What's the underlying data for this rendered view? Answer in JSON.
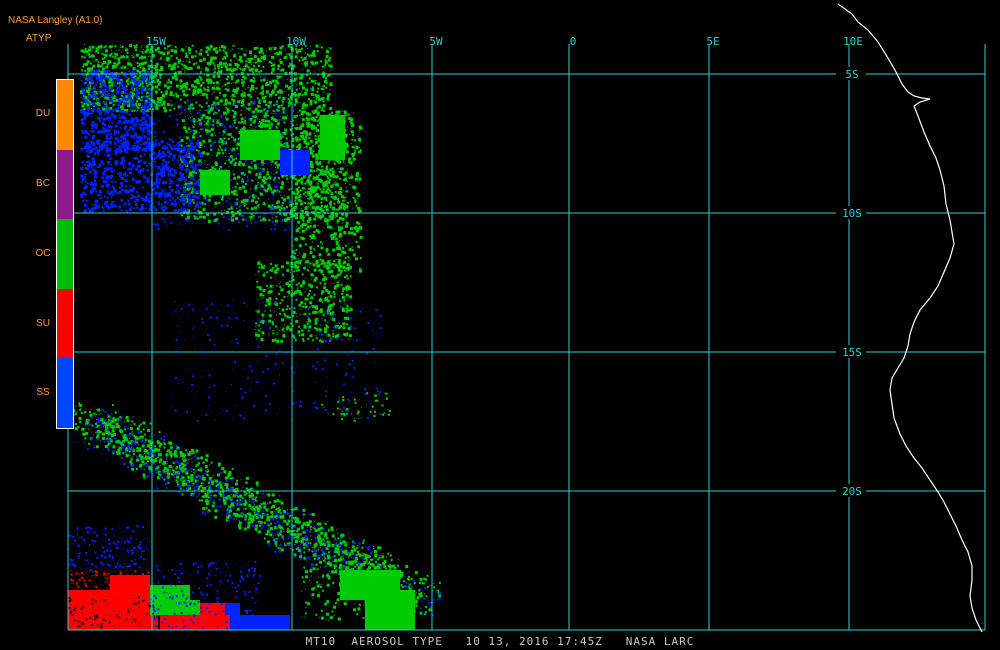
{
  "header": {
    "source": "NASA Langley (A1.0)",
    "product": "ATYP"
  },
  "footer": {
    "caption": "MT10  AEROSOL TYPE   10 13, 2016 17:45Z   NASA LARC"
  },
  "legend": {
    "items": [
      {
        "label": "DU",
        "color": "#ff8800"
      },
      {
        "label": "BC",
        "color": "#8b1a8b"
      },
      {
        "label": "OC",
        "color": "#00bb00"
      },
      {
        "label": "SU",
        "color": "#ff0000"
      },
      {
        "label": "SS",
        "color": "#0044ff"
      }
    ]
  },
  "grid": {
    "lon_labels": [
      "15W",
      "10W",
      "5W",
      "0",
      "5E",
      "10E"
    ],
    "lat_labels": [
      "5S",
      "10S",
      "15S",
      "20S"
    ],
    "line_color": "#33cccc"
  },
  "colors": {
    "coastline": "#ffffff",
    "background": "#000000",
    "ss": "#0022ff",
    "oc": "#00cc00",
    "su": "#ff0000"
  }
}
